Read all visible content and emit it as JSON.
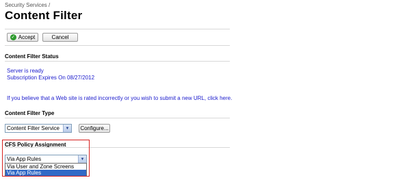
{
  "breadcrumb": "Security Services /",
  "page_title": "Content Filter",
  "toolbar": {
    "accept_label": "Accept",
    "cancel_label": "Cancel"
  },
  "status_section": {
    "title": "Content Filter Status",
    "server_status": "Server is ready",
    "subscription": "Subscription Expires On 08/27/2012",
    "report_text": "If you believe that a Web site is rated incorrectly or you wish to submit a new URL, click here."
  },
  "type_section": {
    "title": "Content Filter Type",
    "selected": "Content Filter Service",
    "configure_label": "Configure..."
  },
  "policy_section": {
    "title": "CFS Policy Assignment",
    "selected": "Via App Rules",
    "options": [
      "Via User and Zone Screens",
      "Via App Rules"
    ]
  },
  "colors": {
    "highlight": "#d6201f",
    "link": "#1a1acc",
    "selection": "#3169c6"
  },
  "icons": [
    "check-icon",
    "chevron-down-icon"
  ]
}
